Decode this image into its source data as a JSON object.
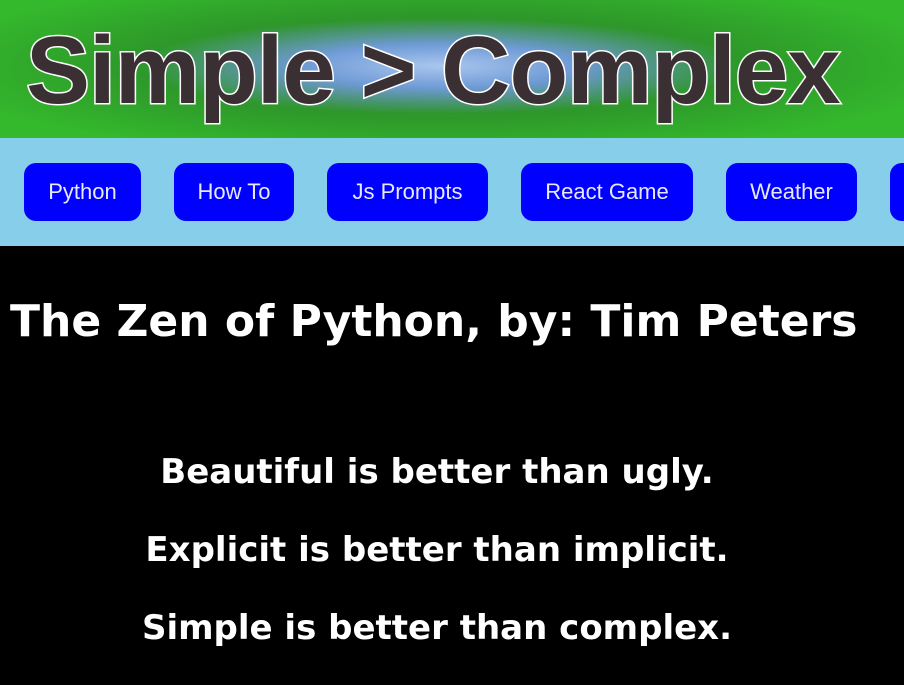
{
  "header": {
    "title": "Simple > Complex"
  },
  "nav": {
    "items": [
      {
        "label": "Python"
      },
      {
        "label": "How To"
      },
      {
        "label": "Js Prompts"
      },
      {
        "label": "React Game"
      },
      {
        "label": "Weather"
      },
      {
        "label": ""
      }
    ]
  },
  "main": {
    "title": "The Zen of Python, by: Tim Peters",
    "lines": [
      "Beautiful is better than ugly.",
      "Explicit is better than implicit.",
      "Simple is better than complex."
    ]
  },
  "colors": {
    "banner_green": "#2e9a2a",
    "banner_glow": "#a9c6ee",
    "nav_background": "#87ceeb",
    "nav_button": "#0000ff",
    "page_background": "#000000",
    "text": "#ffffff"
  }
}
